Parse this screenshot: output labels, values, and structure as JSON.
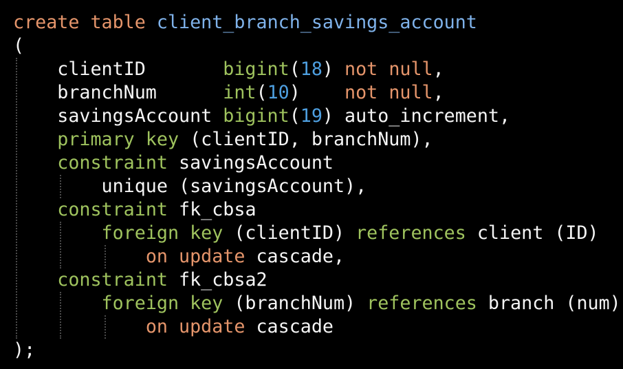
{
  "colors": {
    "background": "#000000",
    "text": "#f5f5f5",
    "keyword_orange": "#e5956b",
    "keyword_green": "#9fc35e",
    "identifier_blue": "#7fb2ea",
    "number": "#4e9fe0",
    "indent_guide": "#4a4a4a"
  },
  "code": {
    "lines": [
      [
        {
          "text": "create table",
          "role": "kw-orange"
        },
        {
          "text": " ",
          "role": "plain"
        },
        {
          "text": "client_branch_savings_account",
          "role": "kw-blue"
        }
      ],
      [
        {
          "text": "(",
          "role": "plain"
        }
      ],
      [
        {
          "text": "    clientID       ",
          "role": "plain"
        },
        {
          "text": "bigint",
          "role": "kw-green"
        },
        {
          "text": "(",
          "role": "plain"
        },
        {
          "text": "18",
          "role": "num"
        },
        {
          "text": ") ",
          "role": "plain"
        },
        {
          "text": "not null",
          "role": "kw-orange"
        },
        {
          "text": ",",
          "role": "plain"
        }
      ],
      [
        {
          "text": "    branchNum      ",
          "role": "plain"
        },
        {
          "text": "int",
          "role": "kw-green"
        },
        {
          "text": "(",
          "role": "plain"
        },
        {
          "text": "10",
          "role": "num"
        },
        {
          "text": ")    ",
          "role": "plain"
        },
        {
          "text": "not null",
          "role": "kw-orange"
        },
        {
          "text": ",",
          "role": "plain"
        }
      ],
      [
        {
          "text": "    savingsAccount ",
          "role": "plain"
        },
        {
          "text": "bigint",
          "role": "kw-green"
        },
        {
          "text": "(",
          "role": "plain"
        },
        {
          "text": "19",
          "role": "num"
        },
        {
          "text": ") auto_increment,",
          "role": "plain"
        }
      ],
      [
        {
          "text": "    ",
          "role": "plain"
        },
        {
          "text": "primary key",
          "role": "kw-green"
        },
        {
          "text": " (clientID, branchNum),",
          "role": "plain"
        }
      ],
      [
        {
          "text": "    ",
          "role": "plain"
        },
        {
          "text": "constraint",
          "role": "kw-green"
        },
        {
          "text": " savingsAccount",
          "role": "plain"
        }
      ],
      [
        {
          "text": "        unique (savingsAccount),",
          "role": "plain"
        }
      ],
      [
        {
          "text": "    ",
          "role": "plain"
        },
        {
          "text": "constraint",
          "role": "kw-green"
        },
        {
          "text": " fk_cbsa",
          "role": "plain"
        }
      ],
      [
        {
          "text": "        ",
          "role": "plain"
        },
        {
          "text": "foreign key",
          "role": "kw-green"
        },
        {
          "text": " (clientID) ",
          "role": "plain"
        },
        {
          "text": "references",
          "role": "kw-green"
        },
        {
          "text": " client (ID)",
          "role": "plain"
        }
      ],
      [
        {
          "text": "            ",
          "role": "plain"
        },
        {
          "text": "on update",
          "role": "kw-orange"
        },
        {
          "text": " cascade,",
          "role": "plain"
        }
      ],
      [
        {
          "text": "    ",
          "role": "plain"
        },
        {
          "text": "constraint",
          "role": "kw-green"
        },
        {
          "text": " fk_cbsa2",
          "role": "plain"
        }
      ],
      [
        {
          "text": "        ",
          "role": "plain"
        },
        {
          "text": "foreign key",
          "role": "kw-green"
        },
        {
          "text": " (branchNum) ",
          "role": "plain"
        },
        {
          "text": "references",
          "role": "kw-green"
        },
        {
          "text": " branch (num)",
          "role": "plain"
        }
      ],
      [
        {
          "text": "            ",
          "role": "plain"
        },
        {
          "text": "on update",
          "role": "kw-orange"
        },
        {
          "text": " cascade",
          "role": "plain"
        }
      ],
      [
        {
          "text": ");",
          "role": "plain"
        }
      ]
    ]
  }
}
